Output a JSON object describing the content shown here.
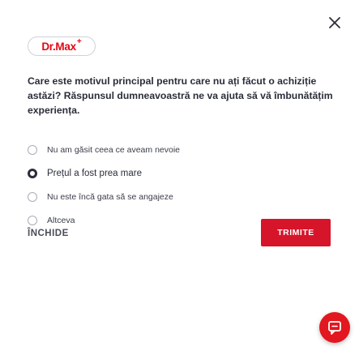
{
  "brand": {
    "logo_text": "Dr.Max",
    "logo_plus": "+"
  },
  "survey": {
    "question": "Care este motivul principal pentru care nu ați făcut o achiziție astăzi? Răspunsul dumneavoastră ne va ajuta să vă îmbunătățim experiența.",
    "options": [
      {
        "label": "Nu am găsit ceea ce aveam nevoie",
        "selected": false
      },
      {
        "label": "Prețul a fost prea mare",
        "selected": true
      },
      {
        "label": "Nu este încă gata să se angajeze",
        "selected": false
      },
      {
        "label": "Altceva",
        "selected": false
      }
    ],
    "close_label": "ÎNCHIDE",
    "submit_label": "TRIMITE"
  },
  "icons": {
    "close": "close-icon",
    "chat": "chat-icon"
  },
  "colors": {
    "brand_red": "#e30613",
    "submit_bg": "#d6152a",
    "text_dark": "#2b2d3a"
  }
}
